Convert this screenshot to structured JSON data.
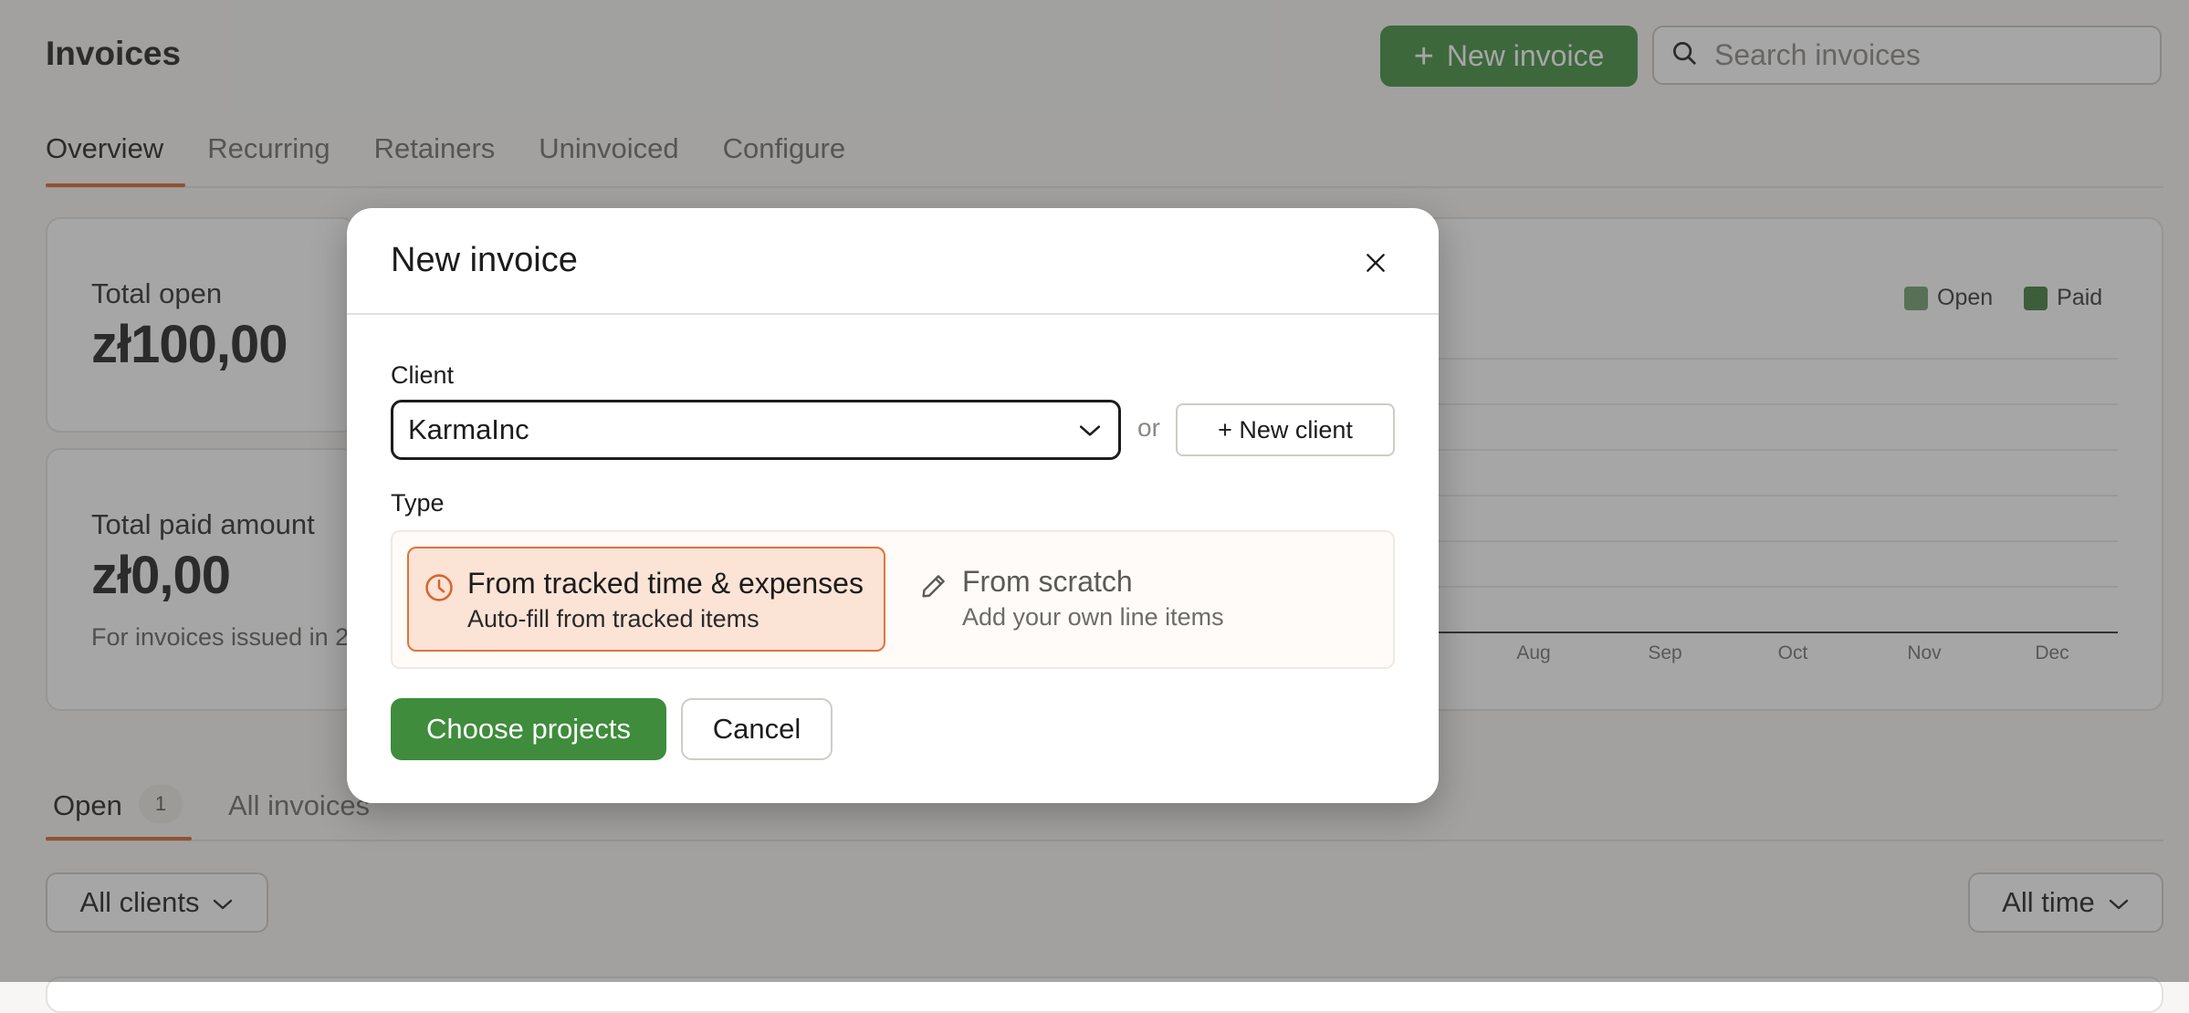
{
  "header": {
    "title": "Invoices",
    "new_invoice_label": "New invoice",
    "search_placeholder": "Search invoices"
  },
  "tabs": [
    "Overview",
    "Recurring",
    "Retainers",
    "Uninvoiced",
    "Configure"
  ],
  "summary": {
    "open_label": "Total open",
    "open_value": "zł100,00",
    "paid_label": "Total paid amount",
    "paid_value": "zł0,00",
    "paid_note": "For invoices issued in 2"
  },
  "chart": {
    "legend": [
      {
        "name": "Open",
        "color": "#6f9d6c"
      },
      {
        "name": "Paid",
        "color": "#3b7a39"
      }
    ],
    "months": [
      "Aug",
      "Sep",
      "Oct",
      "Nov",
      "Dec"
    ]
  },
  "lower_tabs": {
    "open_label": "Open",
    "open_count": "1",
    "all_label": "All invoices"
  },
  "filters": {
    "clients": "All clients",
    "time": "All time"
  },
  "modal": {
    "title": "New invoice",
    "client_label": "Client",
    "client_value": "KarmaInc",
    "or_text": "or",
    "new_client_label": "+ New client",
    "type_label": "Type",
    "options": [
      {
        "title": "From tracked time & expenses",
        "subtitle": "Auto-fill from tracked items"
      },
      {
        "title": "From scratch",
        "subtitle": "Add your own line items"
      }
    ],
    "primary_label": "Choose projects",
    "cancel_label": "Cancel"
  },
  "colors": {
    "accent_green": "#3e8c3c",
    "tab_underline": "#d8652c",
    "selected_option_bg": "#fbe3d6"
  }
}
